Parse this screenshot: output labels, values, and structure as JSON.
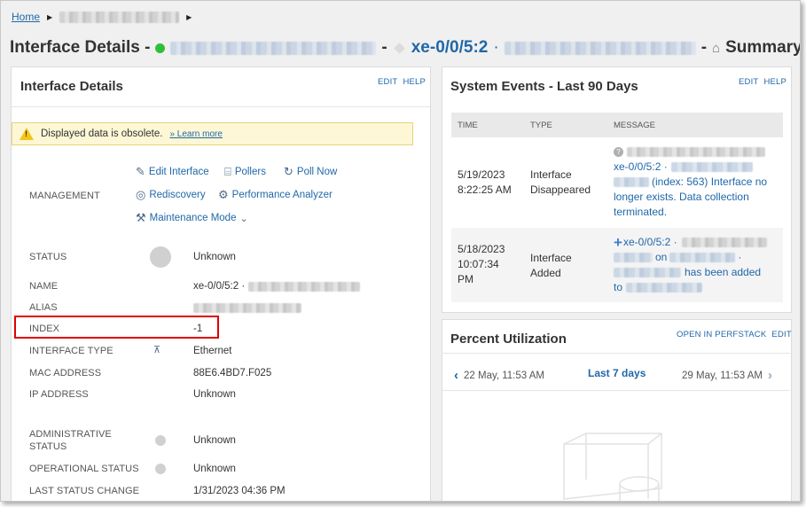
{
  "breadcrumb": {
    "home": "Home"
  },
  "title": {
    "prefix": "Interface Details -",
    "sep1": "-",
    "interface": "xe-0/0/5:2",
    "sep2": "-",
    "page": "Summary"
  },
  "left_panel": {
    "title": "Interface Details",
    "links": [
      "EDIT",
      "HELP"
    ],
    "warning": {
      "text": "Displayed data is obsolete.",
      "link": "» Learn more"
    },
    "management": {
      "label": "MANAGEMENT",
      "actions": {
        "edit_interface": "Edit Interface",
        "pollers": "Pollers",
        "poll_now": "Poll Now",
        "rediscovery": "Rediscovery",
        "performance_analyzer": "Performance Analyzer",
        "maintenance_mode": "Maintenance Mode"
      }
    },
    "fields": {
      "status": {
        "label": "STATUS",
        "value": "Unknown"
      },
      "name": {
        "label": "NAME",
        "value": "xe-0/0/5:2 ·"
      },
      "alias": {
        "label": "ALIAS"
      },
      "index": {
        "label": "INDEX",
        "value": "-1"
      },
      "interface_type": {
        "label": "INTERFACE TYPE",
        "value": "Ethernet"
      },
      "mac_address": {
        "label": "MAC ADDRESS",
        "value": "88E6.4BD7.F025"
      },
      "ip_address": {
        "label": "IP ADDRESS",
        "value": "Unknown"
      },
      "admin_status": {
        "label_line1": "ADMINISTRATIVE",
        "label_line2": "STATUS",
        "value": "Unknown"
      },
      "oper_status": {
        "label": "OPERATIONAL STATUS",
        "value": "Unknown"
      },
      "last_change": {
        "label": "LAST STATUS CHANGE",
        "value": "1/31/2023 04:36 PM"
      }
    }
  },
  "events_panel": {
    "title": "System Events - Last 90 Days",
    "links": [
      "EDIT",
      "HELP"
    ],
    "columns": [
      "TIME",
      "TYPE",
      "MESSAGE"
    ],
    "rows": [
      {
        "time_line1": "5/19/2023",
        "time_line2": "8:22:25 AM",
        "type_line1": "Interface",
        "type_line2": "Disappeared",
        "msg_line2": "xe-0/0/5:2 ·",
        "msg_line3": "(index: 563) Interface no",
        "msg_line4": "longer exists. Data collection",
        "msg_line5": "terminated."
      },
      {
        "time_line1": "5/18/2023",
        "time_line2": "10:07:34",
        "time_line3": "PM",
        "type_line1": "Interface",
        "type_line2": "Added",
        "msg_line1": "xe-0/0/5:2 ·",
        "msg_line2": "on",
        "msg_line2b": "·",
        "msg_line3": "has been added",
        "msg_line4": "to"
      }
    ]
  },
  "util_panel": {
    "title": "Percent Utilization",
    "links": [
      "OPEN IN PERFSTACK",
      "EDIT"
    ],
    "from": "22 May, 11:53 AM",
    "range": "Last 7 days",
    "to": "29 May, 11:53 AM"
  },
  "colors": {
    "link": "#1f67a8",
    "status_up": "#2fbf3c",
    "highlight": "#e00000",
    "warning_bg": "#fdf7d6"
  }
}
